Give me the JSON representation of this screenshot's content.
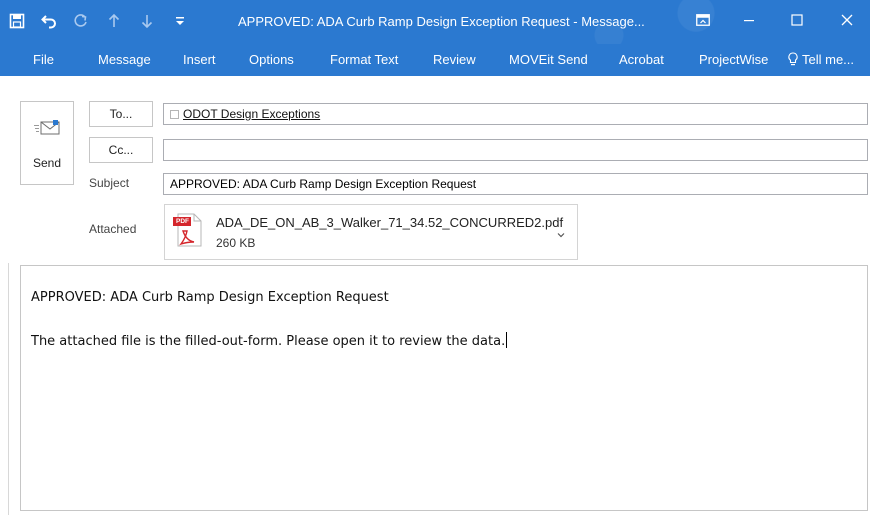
{
  "window": {
    "title": "APPROVED: ADA Curb Ramp Design Exception Request - Message...",
    "accent": "#2b79d0"
  },
  "qat": {
    "icons": [
      "save-icon",
      "undo-icon",
      "redo-icon",
      "up-arrow-icon",
      "down-arrow-icon",
      "customize-qat-icon"
    ]
  },
  "ribbon": {
    "tabs": [
      "File",
      "Message",
      "Insert",
      "Options",
      "Format Text",
      "Review",
      "MOVEit Send",
      "Acrobat",
      "ProjectWise"
    ],
    "tell_me": "Tell me..."
  },
  "compose": {
    "send_label": "Send",
    "to_label": "To...",
    "cc_label": "Cc...",
    "subject_label": "Subject",
    "attached_label": "Attached",
    "to_recipient": "ODOT Design Exceptions",
    "cc_value": "",
    "subject_value": "APPROVED: ADA Curb Ramp Design Exception Request",
    "attachment": {
      "file_name": "ADA_DE_ON_AB_3_Walker_71_34.52_CONCURRED2.pdf",
      "file_size": "260 KB",
      "icon_text": "PDF"
    }
  },
  "body": {
    "line1": "APPROVED: ADA Curb Ramp Design Exception Request",
    "line2": "The attached file is the filled-out-form. Please open it to review the data."
  }
}
